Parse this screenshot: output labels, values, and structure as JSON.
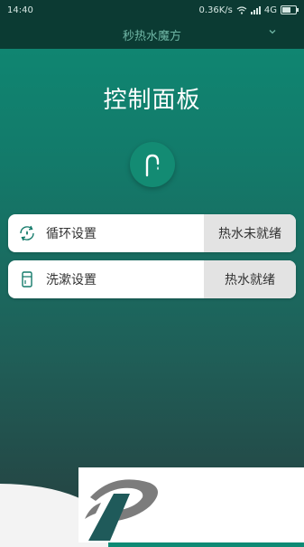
{
  "status_bar": {
    "time": "14:40",
    "speed": "0.36K/s",
    "network": "4G"
  },
  "app_bar": {
    "device_name": "秒热水魔方",
    "dropdown_icon": "chevron-down-icon"
  },
  "page": {
    "title": "控制面板",
    "main_icon": "faucet-icon"
  },
  "settings": [
    {
      "label": "循环设置",
      "status": "热水未就绪",
      "icon": "cycle-icon"
    },
    {
      "label": "洗漱设置",
      "status": "热水就绪",
      "icon": "washbasin-icon"
    }
  ],
  "colors": {
    "primary": "#0e8a74",
    "dark_header": "#0b3b33",
    "status_bg": "#e3e3e3"
  }
}
